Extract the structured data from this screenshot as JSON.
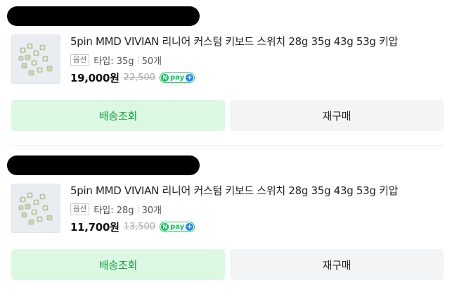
{
  "orders": [
    {
      "product_title": "5pin MMD VIVIAN 리니어 커스텀 키보드 스위치 28g 35g 43g 53g 키압",
      "option_badge": "옵션",
      "option_type": "타입: 35g",
      "option_qty": "50개",
      "price": "19,000원",
      "original_price": "22,500",
      "npay_label": "pay",
      "track_button": "배송조회",
      "reorder_button": "재구매"
    },
    {
      "product_title": "5pin MMD VIVIAN 리니어 커스텀 키보드 스위치 28g 35g 43g 53g 키압",
      "option_badge": "옵션",
      "option_type": "타입: 28g",
      "option_qty": "30개",
      "price": "11,700원",
      "original_price": "13,500",
      "npay_label": "pay",
      "track_button": "배송조회",
      "reorder_button": "재구매"
    }
  ],
  "colors": {
    "track_button_bg": "#dcf8e2",
    "track_button_text": "#13a23f",
    "reorder_button_bg": "#f3f4f6",
    "npay_green": "#03c75a",
    "npay_plus_blue": "#1a8cff"
  },
  "icons": {
    "npay": "npay-icon",
    "plus": "plus-icon"
  }
}
